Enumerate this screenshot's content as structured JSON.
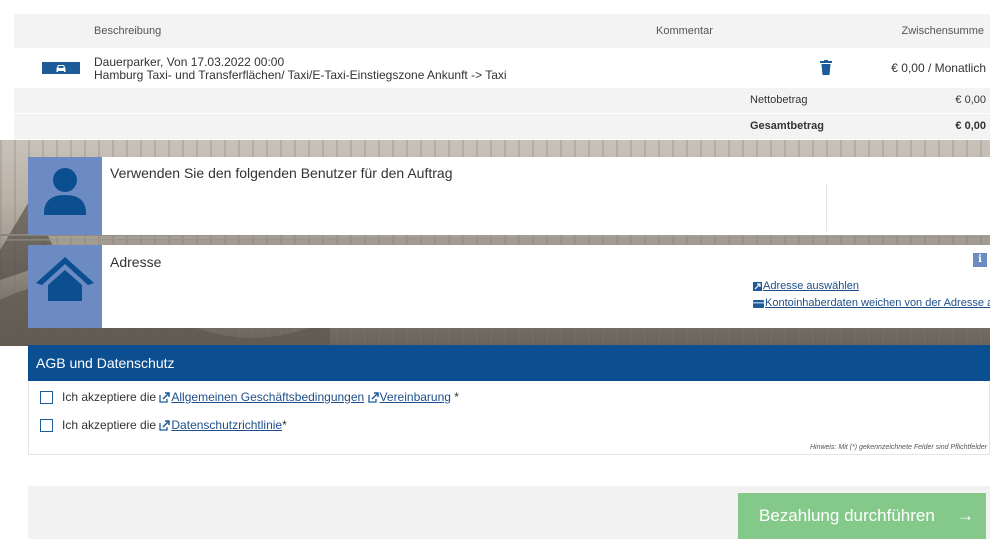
{
  "order_table": {
    "headers": {
      "description": "Beschreibung",
      "comment": "Kommentar",
      "subtotal": "Zwischensumme"
    },
    "item": {
      "category_icon": "car-icon",
      "line1": "Dauerparker, Von 17.03.2022 00:00",
      "line2": "Hamburg Taxi- und Transferflächen/ Taxi/E-Taxi-Einstiegszone Ankunft -> Taxi",
      "subtotal": "€ 0,00 / Monatlich"
    },
    "net_label": "Nettobetrag",
    "net_value": "€ 0,00",
    "total_label": "Gesamtbetrag",
    "total_value": "€ 0,00"
  },
  "user_panel": {
    "title": "Verwenden Sie den folgenden Benutzer für den Auftrag",
    "icon": "user-icon"
  },
  "address_panel": {
    "title": "Adresse",
    "icon": "house-icon",
    "info_icon": "i",
    "select_link": "Adresse auswählen",
    "account_holder_link": "Kontoinhaberdaten weichen von der Adresse ab"
  },
  "agb": {
    "title": "AGB und Datenschutz",
    "row1_prefix": "Ich akzeptiere die ",
    "row1_link1": "Allgemeinen Geschäftsbedingungen",
    "row1_link2": "Vereinbarung",
    "row1_suffix": " *",
    "row2_prefix": "Ich akzeptiere die ",
    "row2_link": "Datenschutzrichtlinie",
    "row2_suffix": "*",
    "hint": "Hinweis: Mit (*) gekennzeichnete Felder sind Pflichtfelder"
  },
  "footer": {
    "pay_button": "Bezahlung durchführen",
    "pay_arrow": "→"
  },
  "colors": {
    "brand_blue": "#0b4f91",
    "avatar_blue": "#6b8bc2",
    "pay_green": "#84c98a"
  }
}
